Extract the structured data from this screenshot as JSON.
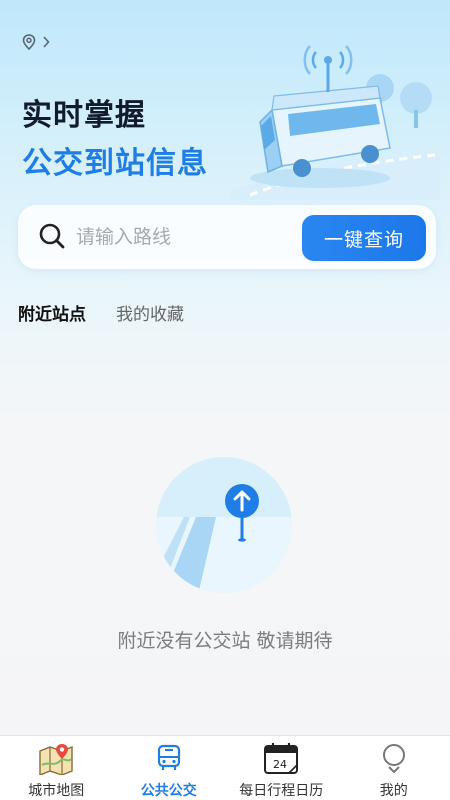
{
  "hero": {
    "line1": "实时掌握",
    "line2": "公交到站信息"
  },
  "search": {
    "placeholder": "请输入路线",
    "value": "",
    "button_label": "一键查询"
  },
  "tabs": [
    {
      "label": "附近站点",
      "active": true
    },
    {
      "label": "我的收藏",
      "active": false
    }
  ],
  "empty_state": {
    "message": "附近没有公交站 敬请期待"
  },
  "calendar_day": "24",
  "bottom_nav": [
    {
      "label": "城市地图",
      "icon": "map-icon",
      "active": false
    },
    {
      "label": "公共公交",
      "icon": "bus-icon",
      "active": true
    },
    {
      "label": "每日行程日历",
      "icon": "calendar-icon",
      "active": false
    },
    {
      "label": "我的",
      "icon": "profile-icon",
      "active": false
    }
  ],
  "colors": {
    "accent": "#1e7de6",
    "title_dark": "#121a2e",
    "muted_text": "#7a7d82"
  }
}
